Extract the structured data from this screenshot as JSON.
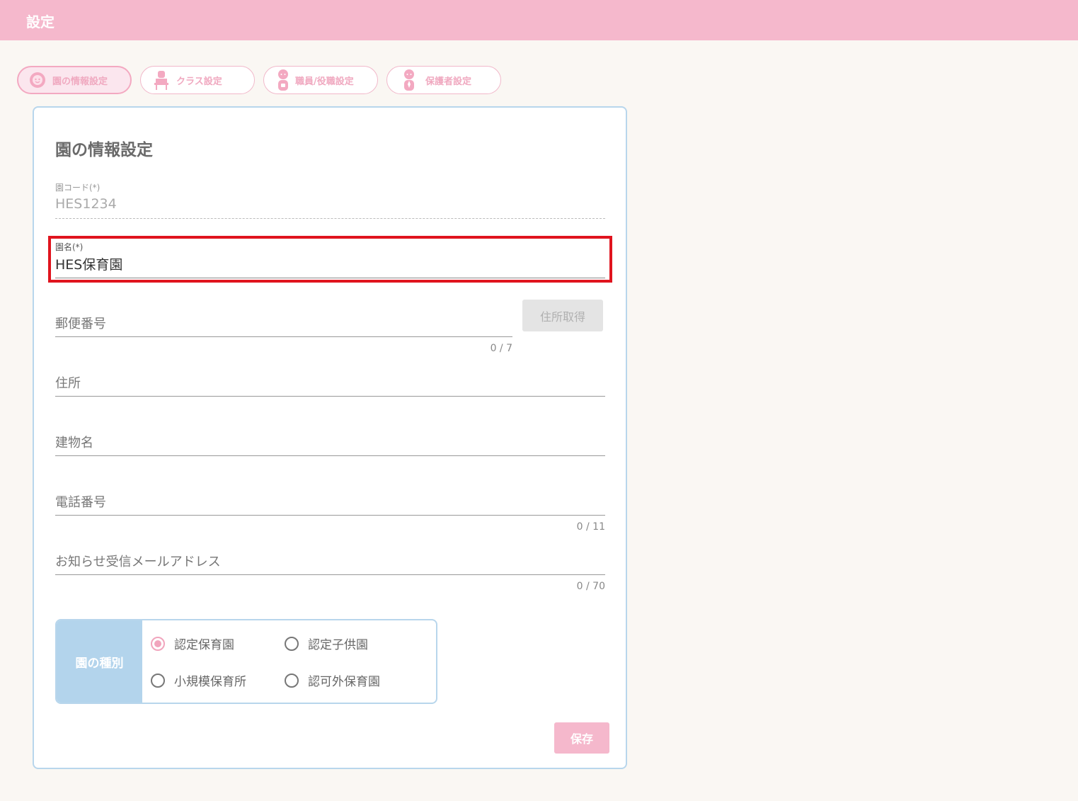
{
  "header": {
    "title": "設定"
  },
  "tabs": [
    {
      "label": "園の情報設定",
      "icon": "gear-face-icon",
      "active": true
    },
    {
      "label": "クラス設定",
      "icon": "teacher-desk-icon",
      "active": false
    },
    {
      "label": "職員/役職設定",
      "icon": "staff-person-icon",
      "active": false
    },
    {
      "label": "保護者設定",
      "icon": "parent-person-icon",
      "active": false
    }
  ],
  "form": {
    "title": "園の情報設定",
    "code": {
      "label": "園コード(*)",
      "value": "HES1234"
    },
    "name": {
      "label": "園名(*)",
      "value": "HES保育園"
    },
    "postal": {
      "placeholder": "郵便番号",
      "counter": "0 / 7"
    },
    "address_button": "住所取得",
    "address": {
      "placeholder": "住所"
    },
    "building": {
      "placeholder": "建物名"
    },
    "phone": {
      "placeholder": "電話番号",
      "counter": "0 / 11"
    },
    "email": {
      "placeholder": "お知らせ受信メールアドレス",
      "counter": "0 / 70"
    },
    "type": {
      "label": "園の種別",
      "options": [
        {
          "label": "認定保育園",
          "checked": true
        },
        {
          "label": "認定子供園",
          "checked": false
        },
        {
          "label": "小規模保育所",
          "checked": false
        },
        {
          "label": "認可外保育園",
          "checked": false
        }
      ]
    },
    "save_label": "保存"
  },
  "colors": {
    "header": "#f5b8cc",
    "accent": "#f1a5bd",
    "panel_border": "#b8d6ec",
    "highlight": "#e0141e"
  }
}
